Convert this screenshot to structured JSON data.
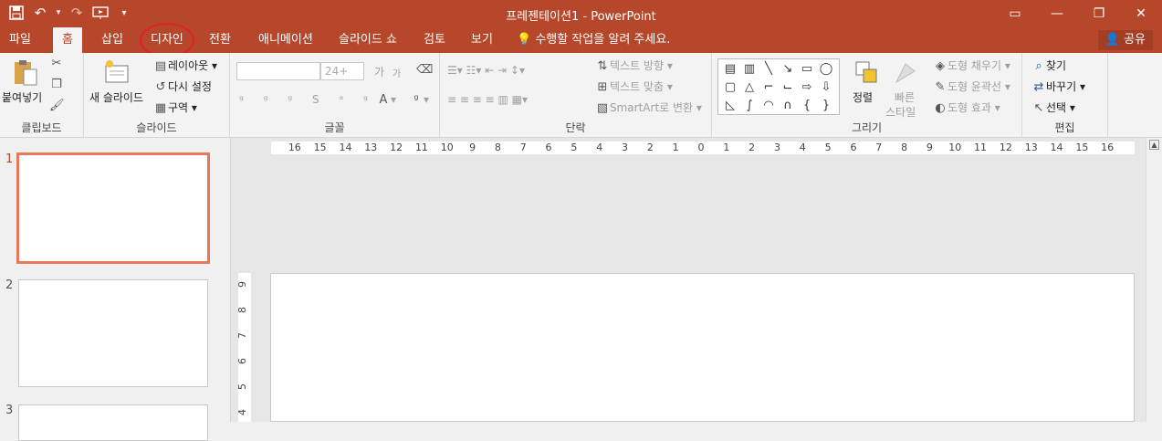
{
  "app": {
    "title": "프레젠테이션1 - PowerPoint",
    "accent": "#b7472a"
  },
  "qat": {
    "save_icon": "save-icon",
    "undo_icon": "undo-icon",
    "redo_icon": "redo-icon",
    "present_icon": "start-slideshow-icon",
    "customize_icon": "customize-qat-icon"
  },
  "tabs": [
    "파일",
    "홈",
    "삽입",
    "디자인",
    "전환",
    "애니메이션",
    "슬라이드 쇼",
    "검토",
    "보기"
  ],
  "active_tab": "홈",
  "annotation_color": "#e0202a",
  "tellme": "수행할 작업을 알려 주세요.",
  "share": "공유",
  "ribbon": {
    "clipboard": {
      "paste": "붙여넣기",
      "label": "클립보드"
    },
    "slides": {
      "new_slide": "새 슬라이드",
      "layout": "레이아웃",
      "reset": "다시 설정",
      "section": "구역",
      "label": "슬라이드"
    },
    "font": {
      "size_placeholder": "24+",
      "grow": "가",
      "shrink": "가",
      "label": "글꼴"
    },
    "paragraph": {
      "text_direction": "텍스트 방향",
      "align_text": "텍스트 맞춤",
      "smartart": "SmartArt로 변환",
      "label": "단락"
    },
    "drawing": {
      "arrange": "정렬",
      "quick_styles_1": "빠른",
      "quick_styles_2": "스타일",
      "shape_fill": "도형 채우기",
      "shape_outline": "도형 윤곽선",
      "shape_effects": "도형 효과",
      "label": "그리기"
    },
    "editing": {
      "find": "찾기",
      "replace": "바꾸기",
      "select": "선택",
      "label": "편집"
    }
  },
  "thumbnails": [
    {
      "number": "1",
      "selected": true
    },
    {
      "number": "2",
      "selected": false
    },
    {
      "number": "3",
      "selected": false
    }
  ],
  "hruler_labels": [
    "16",
    "15",
    "14",
    "13",
    "12",
    "11",
    "10",
    "9",
    "8",
    "7",
    "6",
    "5",
    "4",
    "3",
    "2",
    "1",
    "0",
    "1",
    "2",
    "3",
    "4",
    "5",
    "6",
    "7",
    "8",
    "9",
    "10",
    "11",
    "12",
    "13",
    "14",
    "15",
    "16"
  ],
  "vruler_labels": [
    "9",
    "8",
    "7",
    "6",
    "5",
    "4"
  ]
}
